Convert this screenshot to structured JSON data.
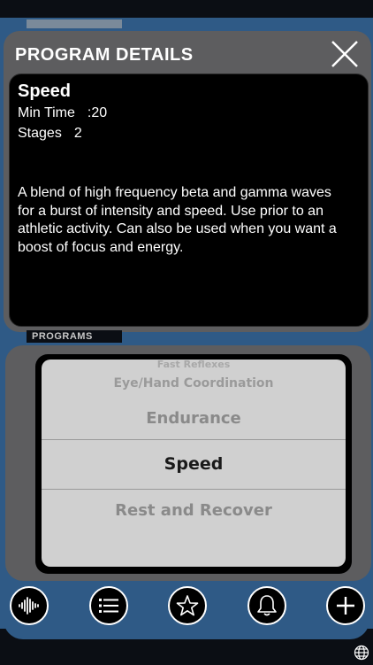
{
  "details": {
    "title": "PROGRAM DETAILS",
    "program_name": "Speed",
    "min_time_label": "Min Time",
    "min_time_value": ":20",
    "stages_label": "Stages",
    "stages_value": "2",
    "description": "A blend of high frequency beta and gamma waves for a burst of intensity and speed.  Use prior to an athletic activity.  Can also be used when you want a boost of focus and energy."
  },
  "programs": {
    "label": "PROGRAMS",
    "items": [
      "Fast Reflexes",
      "Eye/Hand Coordination",
      "Endurance",
      "Speed",
      "Rest and Recover"
    ],
    "selected": "Speed"
  },
  "toolbar": {
    "buttons": [
      "waveform-icon",
      "list-icon",
      "star-icon",
      "bell-icon",
      "plus-icon"
    ]
  },
  "colors": {
    "frame_blue": "#2f5a86",
    "panel_gray": "#5d5d5f",
    "picker_bg": "#d0d0d0"
  }
}
